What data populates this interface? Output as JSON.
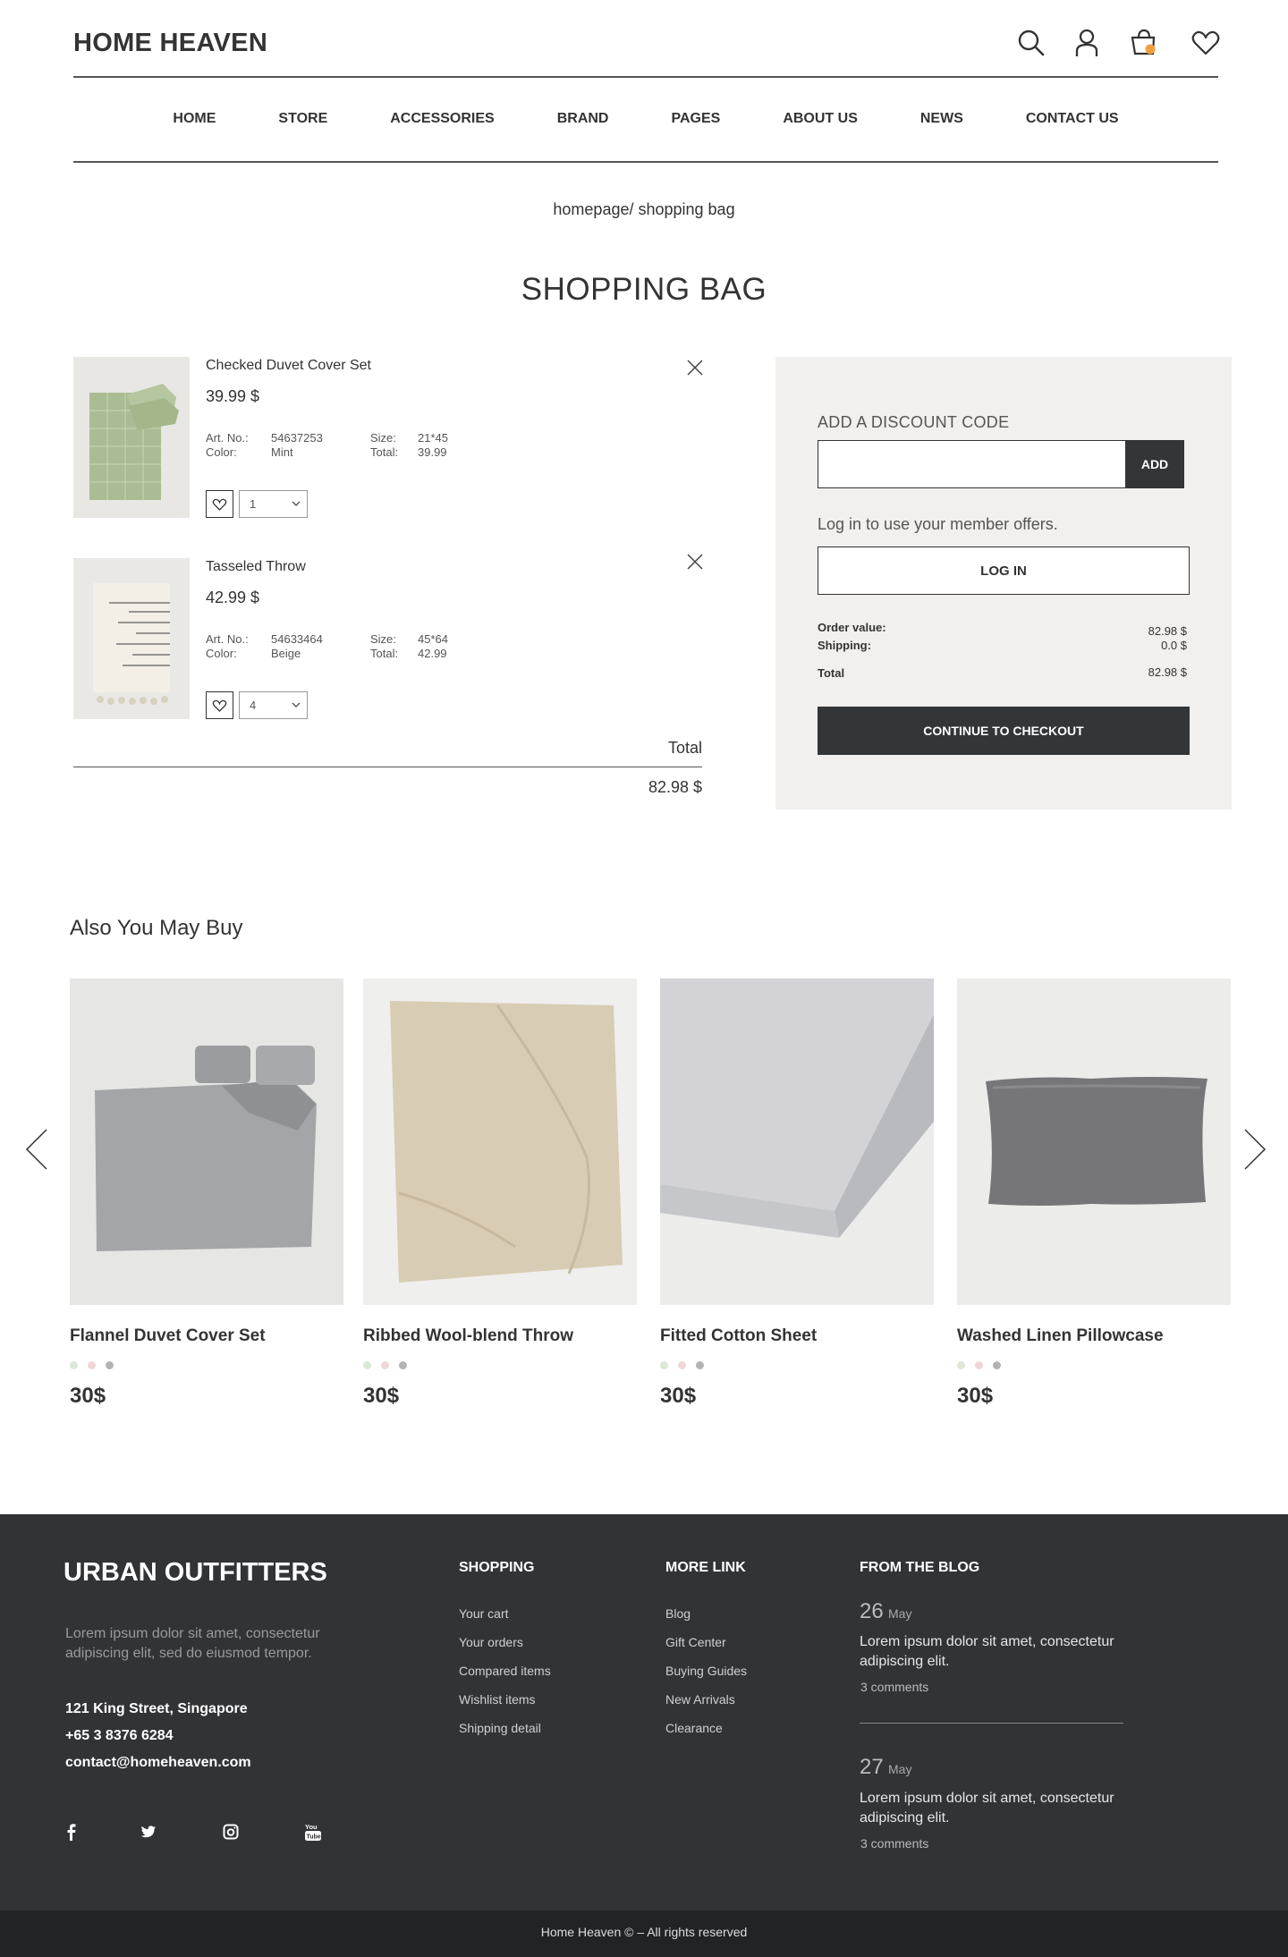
{
  "header": {
    "brand": "HOME HEAVEN",
    "icons": [
      "search-icon",
      "user-icon",
      "cart-icon",
      "heart-icon"
    ],
    "cart_badge": "1"
  },
  "nav": {
    "items": [
      "HOME",
      "STORE",
      "ACCESSORIES",
      "BRAND",
      "PAGES",
      "ABOUT US",
      "NEWS",
      "CONTACT US"
    ]
  },
  "breadcrumb": "homepage/ shopping bag",
  "page_title": "SHOPPING BAG",
  "cart": {
    "items": [
      {
        "name": "Checked Duvet Cover Set",
        "price": "39.99 $",
        "art_label": "Art. No.:",
        "art_no": "54637253",
        "color_label": "Color:",
        "color": "Mint",
        "size_label": "Size:",
        "size": "21*45",
        "total_label": "Total:",
        "total": "39.99",
        "qty": "1"
      },
      {
        "name": "Tasseled Throw",
        "price": "42.99 $",
        "art_label": "Art. No.:",
        "art_no": "54633464",
        "color_label": "Color:",
        "color": "Beige",
        "size_label": "Size:",
        "size": "45*64",
        "total_label": "Total:",
        "total": "42.99",
        "qty": "4"
      }
    ],
    "total_label": "Total",
    "total_value": "82.98 $"
  },
  "summary": {
    "discount_label": "ADD A DISCOUNT CODE",
    "discount_placeholder": "",
    "add_button": "ADD",
    "login_prompt": "Log in to use your member offers.",
    "login_button": "LOG IN",
    "order_value_label": "Order value:",
    "order_value": "82.98 $",
    "shipping_label": "Shipping:",
    "shipping_value": "0.0 $",
    "total_label": "Total",
    "total_value": "82.98 $",
    "checkout_button": "CONTINUE TO CHECKOUT"
  },
  "also_buy": {
    "title": "Also You May Buy",
    "products": [
      {
        "name": "Flannel Duvet Cover Set",
        "price": "30$"
      },
      {
        "name": "Ribbed Wool-blend Throw",
        "price": "30$"
      },
      {
        "name": "Fitted Cotton Sheet",
        "price": "30$"
      },
      {
        "name": "Washed Linen Pillowcase",
        "price": "30$"
      }
    ],
    "swatch_colors": [
      "#dbe8d6",
      "#f0d7d7",
      "#b3b3b3"
    ]
  },
  "footer": {
    "brand": "URBAN OUTFITTERS",
    "description": "Lorem ipsum dolor sit amet, consectetur adipiscing elit, sed do eiusmod tempor.",
    "address": "121 King Street, Singapore",
    "phone": "+65 3 8376 6284",
    "email": "contact@homeheaven.com",
    "social_icons": [
      "facebook-icon",
      "twitter-icon",
      "instagram-icon",
      "youtube-icon"
    ],
    "shopping": {
      "title": "SHOPPING",
      "links": [
        "Your cart",
        "Your orders",
        "Compared items",
        "Wishlist items",
        "Shipping detail"
      ]
    },
    "more": {
      "title": "MORE LINK",
      "links": [
        "Blog",
        "Gift Center",
        "Buying Guides",
        "New Arrivals",
        "Clearance"
      ]
    },
    "blog": {
      "title": "FROM THE BLOG",
      "posts": [
        {
          "day": "26",
          "month": "May",
          "text": "Lorem ipsum dolor sit amet, consectetur adipiscing elit.",
          "comments": "3 comments"
        },
        {
          "day": "27",
          "month": "May",
          "text": "Lorem ipsum dolor sit amet, consectetur adipiscing elit.",
          "comments": "3 comments"
        }
      ]
    },
    "copyright": "Home Heaven © – All rights reserved"
  },
  "colors": {
    "dark": "#333537",
    "footer_bg": "#323335",
    "bottom_bar": "#222325",
    "summary_bg": "#f1f0ee",
    "badge": "#f0a040"
  }
}
